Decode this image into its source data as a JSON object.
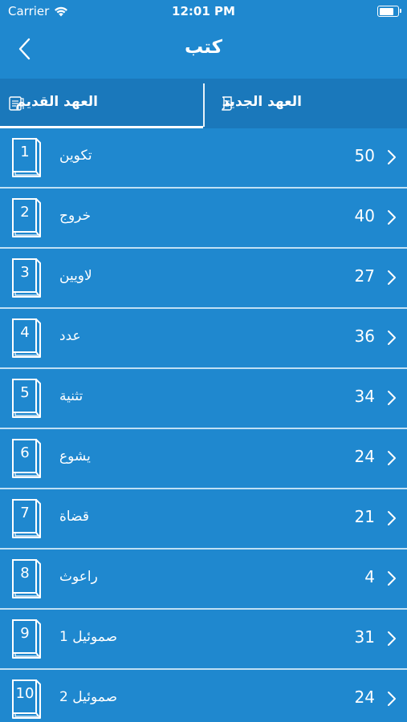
{
  "status_bar": {
    "carrier": "Carrier",
    "time": "12:01 PM",
    "battery_level": 0.9
  },
  "nav": {
    "title": "كتب"
  },
  "tabs": [
    {
      "label": "العهد القديم",
      "selected": true
    },
    {
      "label": "العهد الجديد",
      "selected": false
    }
  ],
  "books": [
    {
      "number": "1",
      "name": "تكوين",
      "chapters": "50"
    },
    {
      "number": "2",
      "name": "خروج",
      "chapters": "40"
    },
    {
      "number": "3",
      "name": "لاويين",
      "chapters": "27"
    },
    {
      "number": "4",
      "name": "عدد",
      "chapters": "36"
    },
    {
      "number": "5",
      "name": "تثنية",
      "chapters": "34"
    },
    {
      "number": "6",
      "name": "يشوع",
      "chapters": "24"
    },
    {
      "number": "7",
      "name": "قضاة",
      "chapters": "21"
    },
    {
      "number": "8",
      "name": "راعوث",
      "chapters": "4"
    },
    {
      "number": "9",
      "name": "1 صموئيل",
      "chapters": "31"
    },
    {
      "number": "10",
      "name": "2 صموئيل",
      "chapters": "24"
    }
  ],
  "colors": {
    "background": "#1f88cf",
    "tab_bar": "#1a78bb",
    "separator": "#bfe0f5",
    "text": "#ffffff"
  }
}
